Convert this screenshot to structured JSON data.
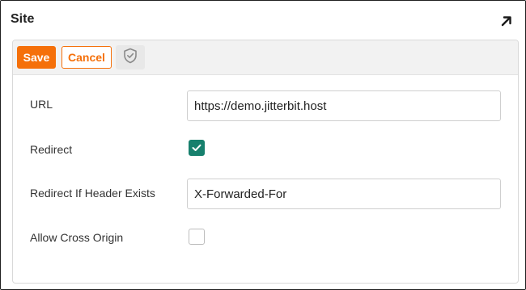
{
  "panel": {
    "title": "Site",
    "expand_icon": "arrow-up-right-icon"
  },
  "toolbar": {
    "save_label": "Save",
    "cancel_label": "Cancel",
    "shield_icon": "shield-check-icon"
  },
  "fields": {
    "url": {
      "label": "URL",
      "value": "https://demo.jitterbit.host"
    },
    "redirect": {
      "label": "Redirect",
      "checked": true
    },
    "redirect_header": {
      "label": "Redirect If Header Exists",
      "value": "X-Forwarded-For"
    },
    "allow_cross_origin": {
      "label": "Allow Cross Origin",
      "checked": false
    }
  },
  "colors": {
    "accent_orange": "#f5700a",
    "checkbox_green": "#17806d"
  }
}
